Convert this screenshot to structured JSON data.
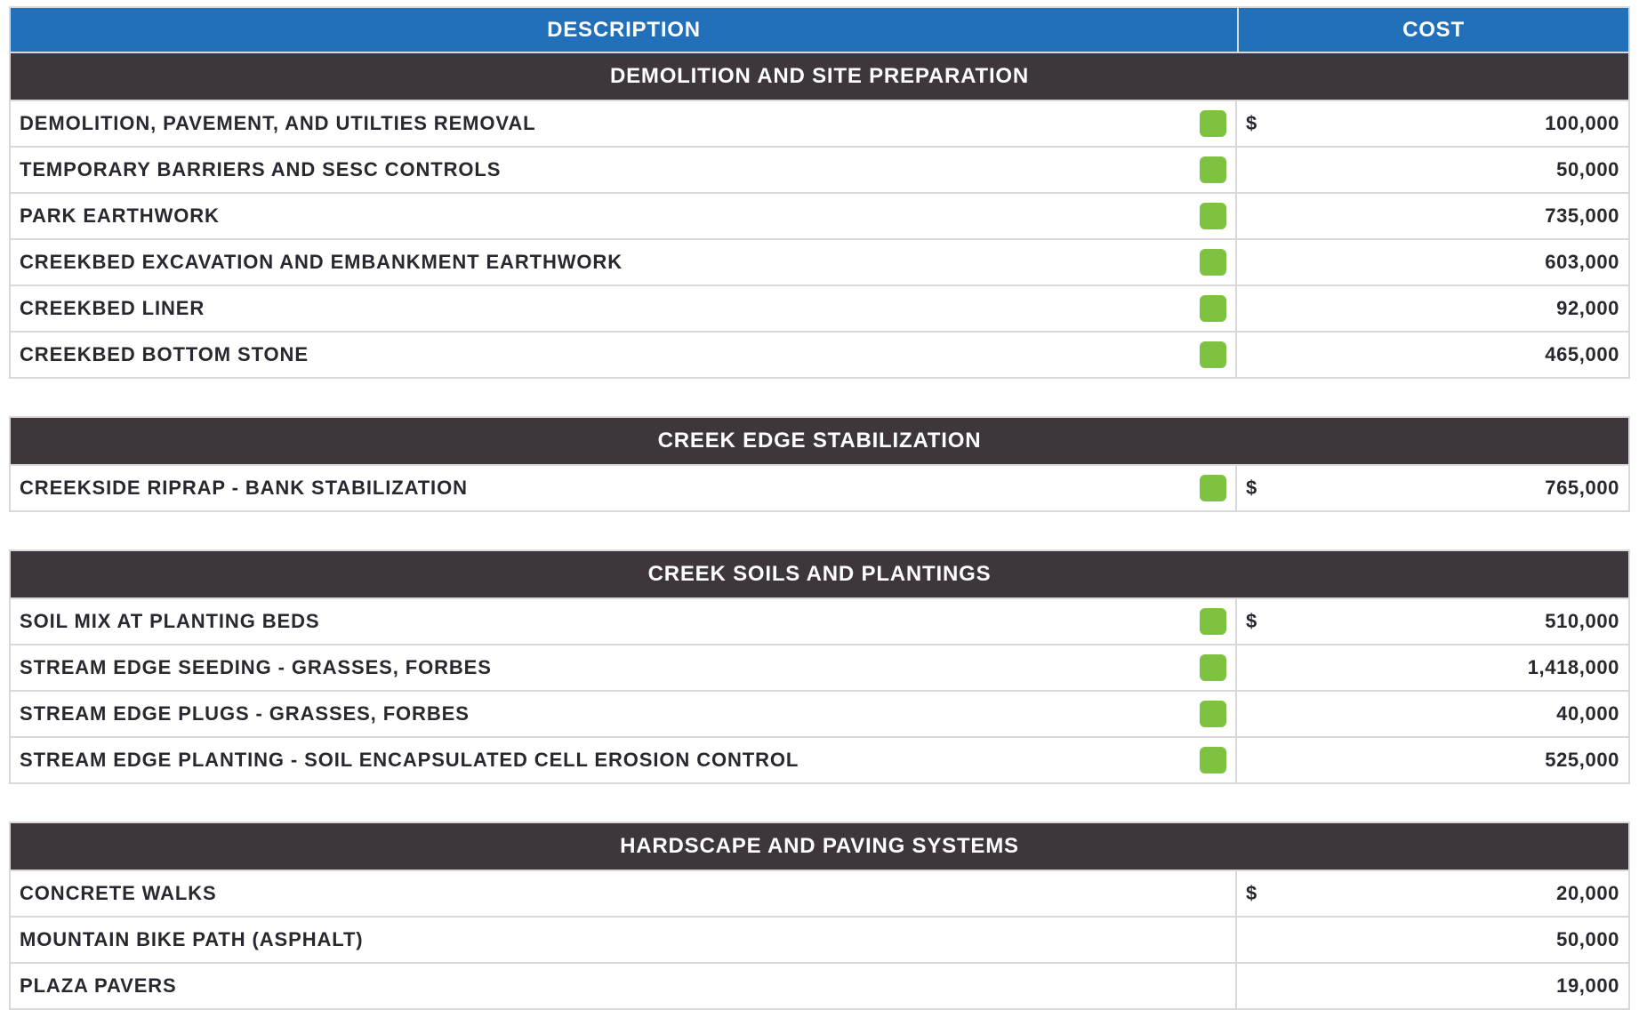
{
  "header": {
    "description": "DESCRIPTION",
    "cost": "COST"
  },
  "colors": {
    "header_blue": "#2270b9",
    "section_dark": "#3d363d",
    "indicator_green": "#7ec242"
  },
  "sections": [
    {
      "title": "DEMOLITION AND SITE PREPARATION",
      "rows": [
        {
          "description": "DEMOLITION, PAVEMENT, AND UTILTIES REMOVAL",
          "currency": "$",
          "cost": "100,000",
          "indicator": true
        },
        {
          "description": "TEMPORARY BARRIERS AND SESC CONTROLS",
          "currency": "",
          "cost": "50,000",
          "indicator": true
        },
        {
          "description": "PARK EARTHWORK",
          "currency": "",
          "cost": "735,000",
          "indicator": true
        },
        {
          "description": "CREEKBED EXCAVATION AND EMBANKMENT EARTHWORK",
          "currency": "",
          "cost": "603,000",
          "indicator": true
        },
        {
          "description": "CREEKBED LINER",
          "currency": "",
          "cost": "92,000",
          "indicator": true
        },
        {
          "description": "CREEKBED BOTTOM STONE",
          "currency": "",
          "cost": "465,000",
          "indicator": true
        }
      ]
    },
    {
      "title": "CREEK EDGE STABILIZATION",
      "rows": [
        {
          "description": "CREEKSIDE RIPRAP - BANK STABILIZATION",
          "currency": "$",
          "cost": "765,000",
          "indicator": true
        }
      ]
    },
    {
      "title": "CREEK SOILS AND PLANTINGS",
      "rows": [
        {
          "description": "SOIL MIX AT PLANTING BEDS",
          "currency": "$",
          "cost": "510,000",
          "indicator": true
        },
        {
          "description": "STREAM EDGE SEEDING - GRASSES, FORBES",
          "currency": "",
          "cost": "1,418,000",
          "indicator": true
        },
        {
          "description": "STREAM EDGE PLUGS - GRASSES, FORBES",
          "currency": "",
          "cost": "40,000",
          "indicator": true
        },
        {
          "description": "STREAM EDGE PLANTING - SOIL ENCAPSULATED CELL EROSION CONTROL",
          "currency": "",
          "cost": "525,000",
          "indicator": true
        }
      ]
    },
    {
      "title": "HARDSCAPE AND PAVING SYSTEMS",
      "rows": [
        {
          "description": "CONCRETE WALKS",
          "currency": "$",
          "cost": "20,000",
          "indicator": false
        },
        {
          "description": "MOUNTAIN BIKE PATH (ASPHALT)",
          "currency": "",
          "cost": "50,000",
          "indicator": false
        },
        {
          "description": "PLAZA PAVERS",
          "currency": "",
          "cost": "19,000",
          "indicator": false
        }
      ]
    }
  ]
}
